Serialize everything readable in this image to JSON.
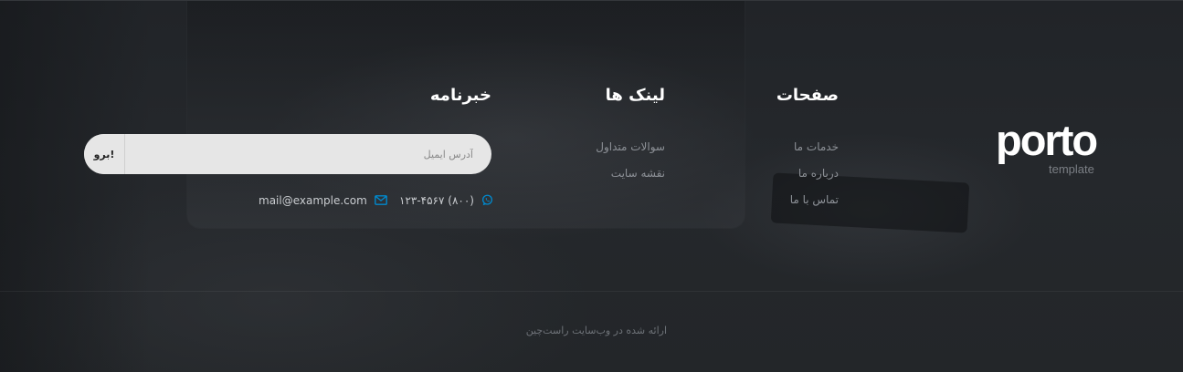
{
  "logo": {
    "word": "porto",
    "sub": "template"
  },
  "columns": {
    "pages": {
      "title": "صفحات",
      "links": [
        "خدمات ما",
        "درباره ما",
        "تماس با ما"
      ]
    },
    "links": {
      "title": "لینک ها",
      "links": [
        "سوالات متداول",
        "نقشه سایت"
      ]
    },
    "newsletter": {
      "title": "خبرنامه",
      "email_placeholder": "آدرس ایمیل",
      "submit_label": "برو!",
      "phone": "(۸۰۰) ۱۲۳-۴۵۶۷",
      "email": "mail@example.com"
    }
  },
  "footer": {
    "copyright": "ارائه شده در وب‌سایت راست‌چین"
  },
  "colors": {
    "accent": "#0088cc",
    "heading": "#ffffff",
    "link": "#8d9197"
  },
  "icons": {
    "phone": "whatsapp-icon",
    "mail": "envelope-icon"
  }
}
